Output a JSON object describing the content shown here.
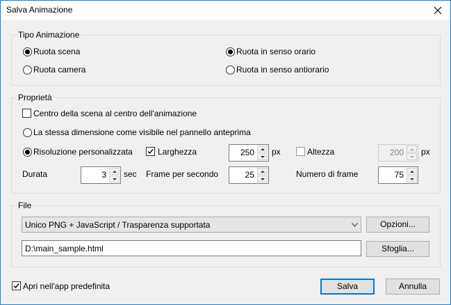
{
  "window": {
    "title": "Salva Animazione"
  },
  "tipo": {
    "legend": "Tipo Animazione",
    "ruota_scena": "Ruota scena",
    "ruota_camera": "Ruota camera",
    "orario": "Ruota in senso orario",
    "antiorario": "Ruota in senso antiorario"
  },
  "proprieta": {
    "legend": "Proprietà",
    "centro": "Centro della scena al centro dell'animazione",
    "stessa": "La stessa dimensione come visibile nel pannello anteprima",
    "personalizzata": "Risoluzione personalizzata",
    "larghezza_label": "Larghezza",
    "larghezza_value": "250",
    "larghezza_unit": "px",
    "altezza_label": "Altezza",
    "altezza_value": "200",
    "altezza_unit": "px",
    "durata_label": "Durata",
    "durata_value": "3",
    "durata_unit": "sec",
    "fps_label": "Frame per secondo",
    "fps_value": "25",
    "frames_label": "Numero di frame",
    "frames_value": "75"
  },
  "file": {
    "legend": "File",
    "format": "Unico PNG + JavaScript / Trasparenza supportata",
    "opzioni": "Opzioni...",
    "path": "D:\\main_sample.html",
    "sfoglia": "Sfoglia..."
  },
  "footer": {
    "apri": "Apri nell'app predefinita",
    "salva": "Salva",
    "annulla": "Annulla"
  }
}
